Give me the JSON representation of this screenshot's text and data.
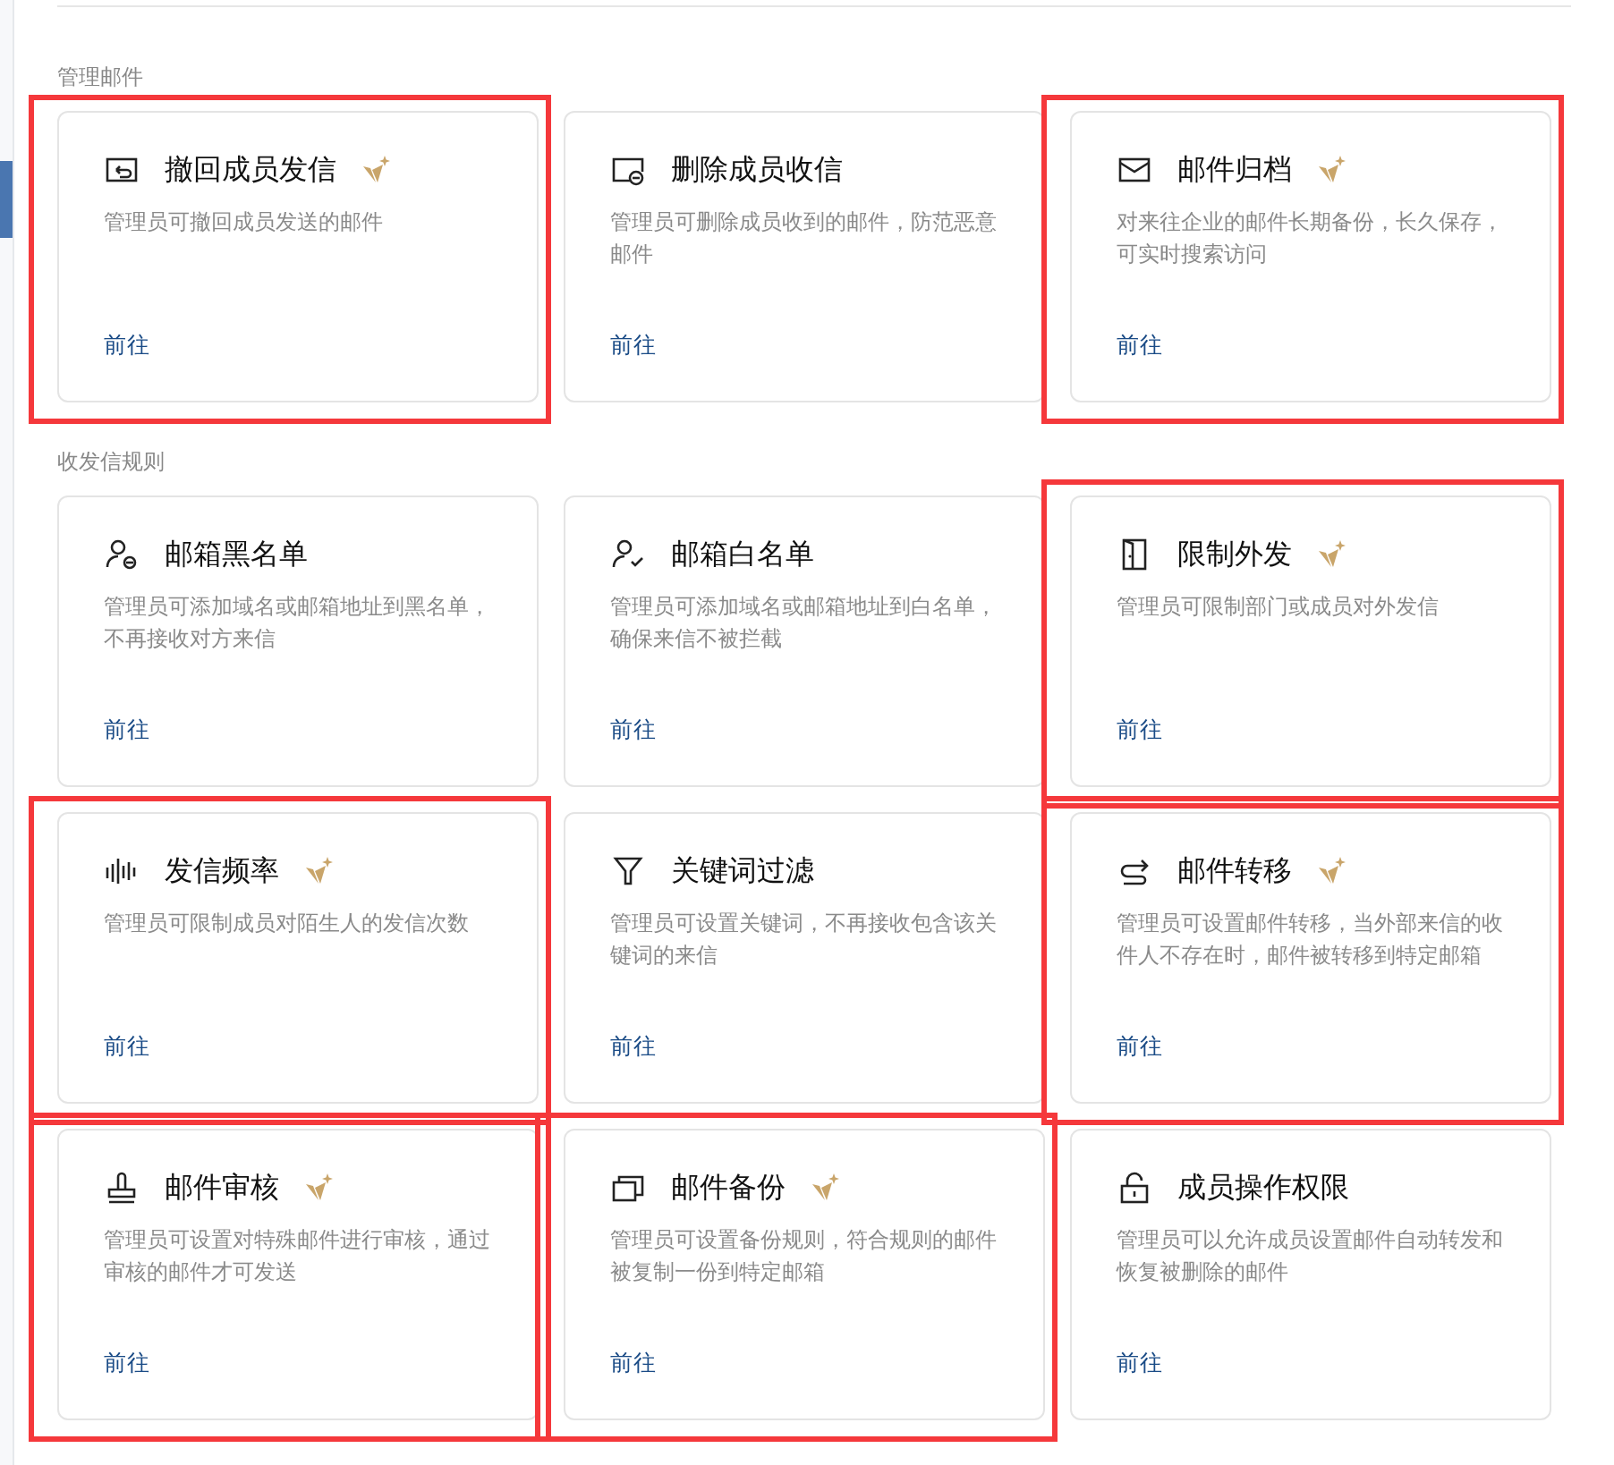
{
  "sections": [
    {
      "title": "管理邮件",
      "cards": [
        {
          "kind": "recall",
          "title": "撤回成员发信",
          "premium": true,
          "highlighted": true,
          "description": "管理员可撤回成员发送的邮件",
          "link": "前往"
        },
        {
          "kind": "delete-mail",
          "title": "删除成员收信",
          "premium": false,
          "highlighted": false,
          "description": "管理员可删除成员收到的邮件，防范恶意邮件",
          "link": "前往"
        },
        {
          "kind": "envelope",
          "title": "邮件归档",
          "premium": true,
          "highlighted": true,
          "description": "对来往企业的邮件长期备份，长久保存，可实时搜索访问",
          "link": "前往"
        }
      ]
    },
    {
      "title": "收发信规则",
      "cards": [
        {
          "kind": "user-minus",
          "title": "邮箱黑名单",
          "premium": false,
          "highlighted": false,
          "description": "管理员可添加域名或邮箱地址到黑名单，不再接收对方来信",
          "link": "前往"
        },
        {
          "kind": "user-check",
          "title": "邮箱白名单",
          "premium": false,
          "highlighted": false,
          "description": "管理员可添加域名或邮箱地址到白名单，确保来信不被拦截",
          "link": "前往"
        },
        {
          "kind": "door",
          "title": "限制外发",
          "premium": true,
          "highlighted": true,
          "description": "管理员可限制部门或成员对外发信",
          "link": "前往"
        },
        {
          "kind": "bars",
          "title": "发信频率",
          "premium": true,
          "highlighted": true,
          "description": "管理员可限制成员对陌生人的发信次数",
          "link": "前往"
        },
        {
          "kind": "filter",
          "title": "关键词过滤",
          "premium": false,
          "highlighted": false,
          "description": "管理员可设置关键词，不再接收包含该关键词的来信",
          "link": "前往"
        },
        {
          "kind": "redirect",
          "title": "邮件转移",
          "premium": true,
          "highlighted": true,
          "description": "管理员可设置邮件转移，当外部来信的收件人不存在时，邮件被转移到特定邮箱",
          "link": "前往"
        },
        {
          "kind": "stamp",
          "title": "邮件审核",
          "premium": true,
          "highlighted": true,
          "description": "管理员可设置对特殊邮件进行审核，通过审核的邮件才可发送",
          "link": "前往"
        },
        {
          "kind": "copies",
          "title": "邮件备份",
          "premium": true,
          "highlighted": true,
          "description": "管理员可设置备份规则，符合规则的邮件被复制一份到特定邮箱",
          "link": "前往"
        },
        {
          "kind": "lock",
          "title": "成员操作权限",
          "premium": false,
          "highlighted": false,
          "description": "管理员可以允许成员设置邮件自动转发和恢复被删除的邮件",
          "link": "前往"
        }
      ]
    }
  ]
}
